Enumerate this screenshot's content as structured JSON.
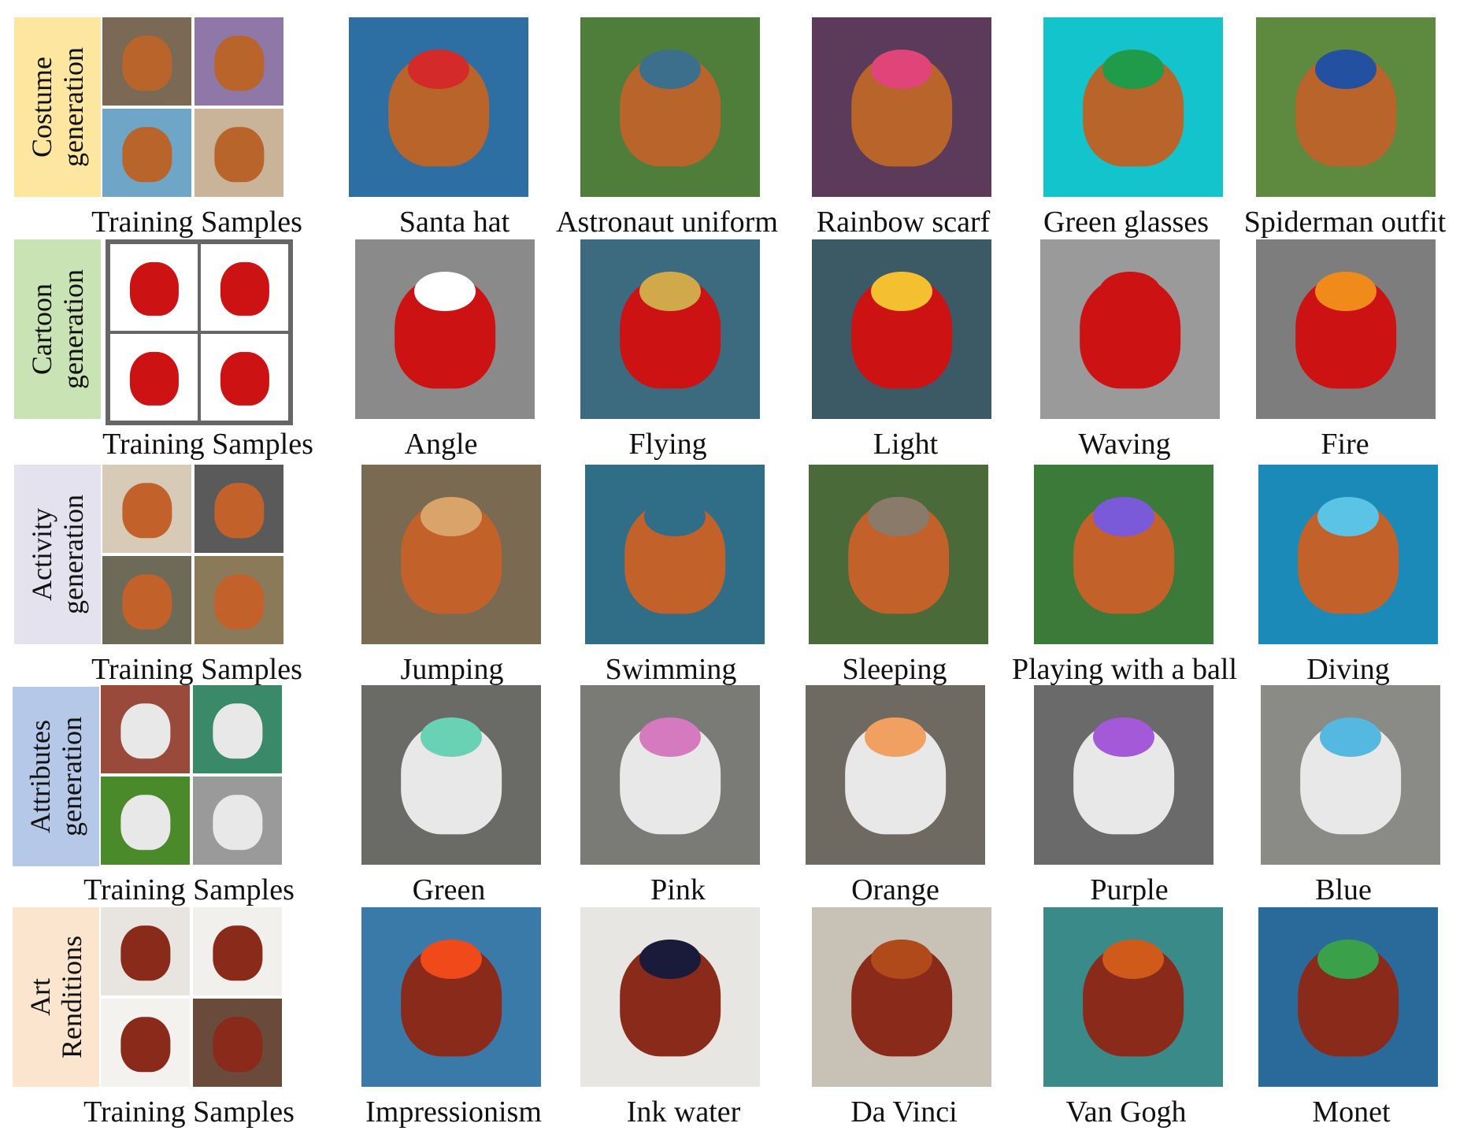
{
  "training_caption": "Training Samples",
  "rows": [
    {
      "label": "Costume\ngeneration",
      "label_bg": "#fde6a0",
      "subject_color": "#b8642a",
      "training_bgs": [
        "#7a6a55",
        "#8f78a8",
        "#6fa6c8",
        "#c9b49a"
      ],
      "outputs": [
        {
          "caption": "Santa hat",
          "bg": "#2d6fa3",
          "accent": "#d42a2a"
        },
        {
          "caption": "Astronaut uniform",
          "bg": "#4f7d3a",
          "accent": "#3b6f8c"
        },
        {
          "caption": "Rainbow scarf",
          "bg": "#5c3b5a",
          "accent": "#e0457a"
        },
        {
          "caption": "Green glasses",
          "bg": "#14c4cc",
          "accent": "#1f9b4a"
        },
        {
          "caption": "Spiderman outfit",
          "bg": "#5d8a3f",
          "accent": "#2350a0"
        }
      ]
    },
    {
      "label": "Cartoon\ngeneration",
      "label_bg": "#c9e3b5",
      "subject_color": "#cc1212",
      "training_bgs": [
        "#ffffff",
        "#ffffff",
        "#ffffff",
        "#ffffff"
      ],
      "outputs": [
        {
          "caption": "Angle",
          "bg": "#8a8a8a",
          "accent": "#ffffff"
        },
        {
          "caption": "Flying",
          "bg": "#3c6b80",
          "accent": "#d1a84a"
        },
        {
          "caption": "Light",
          "bg": "#3b5a66",
          "accent": "#f4c030"
        },
        {
          "caption": "Waving",
          "bg": "#9a9a9a",
          "accent": "#cc1212"
        },
        {
          "caption": "Fire",
          "bg": "#7d7d7d",
          "accent": "#f08a1a"
        }
      ]
    },
    {
      "label": "Activity\ngeneration",
      "label_bg": "#e4e2ee",
      "subject_color": "#c2622a",
      "training_bgs": [
        "#d7cbb8",
        "#5a5a5a",
        "#6e6a58",
        "#8a7a5a"
      ],
      "outputs": [
        {
          "caption": "Jumping",
          "bg": "#7a6a52",
          "accent": "#d9a46a"
        },
        {
          "caption": "Swimming",
          "bg": "#2f6e86",
          "accent": "#2f6e86"
        },
        {
          "caption": "Sleeping",
          "bg": "#4b6a3a",
          "accent": "#8a7a6a"
        },
        {
          "caption": "Playing with a ball",
          "bg": "#3c7a3a",
          "accent": "#7a5ad8"
        },
        {
          "caption": "Diving",
          "bg": "#1c8ab8",
          "accent": "#5bc4e6"
        }
      ]
    },
    {
      "label": "Attributes\ngeneration",
      "label_bg": "#b6c8e8",
      "subject_color": "#e8e8e8",
      "training_bgs": [
        "#9a4a3a",
        "#3a8a6a",
        "#4a8a2a",
        "#9a9a9a"
      ],
      "outputs": [
        {
          "caption": "Green",
          "bg": "#6a6a66",
          "accent": "#6ad2b4"
        },
        {
          "caption": "Pink",
          "bg": "#7a7a76",
          "accent": "#d67ac0"
        },
        {
          "caption": "Orange",
          "bg": "#6e6a62",
          "accent": "#f0a060"
        },
        {
          "caption": "Purple",
          "bg": "#6a6a6a",
          "accent": "#a45ad8"
        },
        {
          "caption": "Blue",
          "bg": "#8a8a86",
          "accent": "#54b8e0"
        }
      ]
    },
    {
      "label": "Art\nRenditions",
      "label_bg": "#fbe5cf",
      "subject_color": "#8a2a1a",
      "training_bgs": [
        "#e8e4e0",
        "#f2f0ec",
        "#f4f2ee",
        "#6a4a3a"
      ],
      "outputs": [
        {
          "caption": "Impressionism",
          "bg": "#3a7aa8",
          "accent": "#f04a1a"
        },
        {
          "caption": "Ink water",
          "bg": "#e8e6e2",
          "accent": "#1a1a3a"
        },
        {
          "caption": "Da Vinci",
          "bg": "#c8c2b6",
          "accent": "#b04a1a"
        },
        {
          "caption": "Van Gogh",
          "bg": "#3a8a8a",
          "accent": "#d05a1a"
        },
        {
          "caption": "Monet",
          "bg": "#2a6a9a",
          "accent": "#3aa04a"
        }
      ]
    }
  ]
}
